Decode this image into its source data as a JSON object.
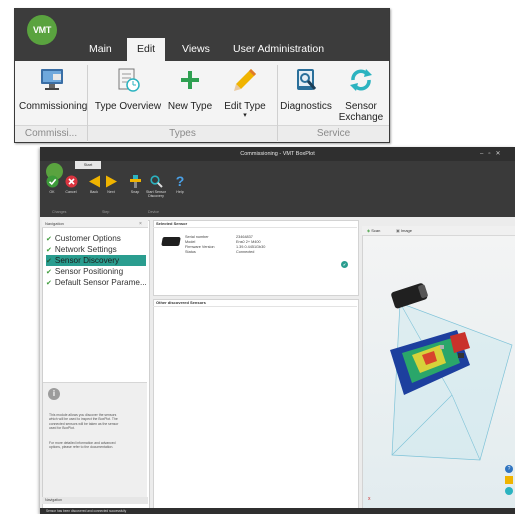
{
  "ribbon": {
    "logo_text": "VMT",
    "tabs": [
      "Main",
      "Edit",
      "Views",
      "User Administration"
    ],
    "active_tab": "Edit",
    "buttons": {
      "commissioning": "Commissioning",
      "type_overview": "Type Overview",
      "new_type": "New Type",
      "edit_type": "Edit Type",
      "diagnostics": "Diagnostics",
      "sensor_exchange": "Sensor Exchange"
    },
    "groups": {
      "commissi": "Commissi...",
      "types": "Types",
      "service": "Service"
    }
  },
  "app": {
    "title": "Commissioning - VMT BoxPlot",
    "start_tab": "Start",
    "toolbar": {
      "ok": "OK",
      "cancel": "Cancel",
      "back": "Back",
      "next": "Next",
      "snap": "Snap",
      "start_discovery": "Start Sensor Discovery",
      "help": "Help"
    },
    "toolbar_groups": {
      "changes": "Changes",
      "step": "Step",
      "device": "Device"
    },
    "navigation": {
      "header": "Navigation",
      "items": [
        {
          "label": "Customer Options",
          "selected": false
        },
        {
          "label": "Network Settings",
          "selected": false
        },
        {
          "label": "Sensor Discovery",
          "selected": true
        },
        {
          "label": "Sensor Positioning",
          "selected": false
        },
        {
          "label": "Default Sensor Parame...",
          "selected": false
        }
      ],
      "info_paragraph_1": "This module allows you discover the sensors which will be used to inspect the BoxPlot. The connected sensors will be taken as the sensor used for BoxPlot.",
      "info_paragraph_2": "For more detailed information and advanced options, please refer to the documentation.",
      "footer": "Navigation"
    },
    "selected_sensor": {
      "header": "Selected Sensor",
      "fields": [
        {
          "key": "Serial number",
          "value": "23464837"
        },
        {
          "key": "Model",
          "value": "Ens0 2+ M400"
        },
        {
          "key": "Firmware Version",
          "value": "1.39.0.4451Gb30"
        },
        {
          "key": "Status",
          "value": "Connected"
        }
      ]
    },
    "other_sensors": {
      "header": "Other discovered Sensors"
    },
    "view": {
      "tabs": [
        "Scan",
        "Image"
      ]
    },
    "status_bar": "Sensor has been discovered and connected successfully"
  },
  "colors": {
    "vmt_green": "#5aa33f",
    "selection_teal": "#2a9d8f",
    "ribbon_dark": "#3c3c3c",
    "plus_green": "#2fa052",
    "sync_teal": "#2bb3c0",
    "arrow_yellow": "#f0b400"
  }
}
